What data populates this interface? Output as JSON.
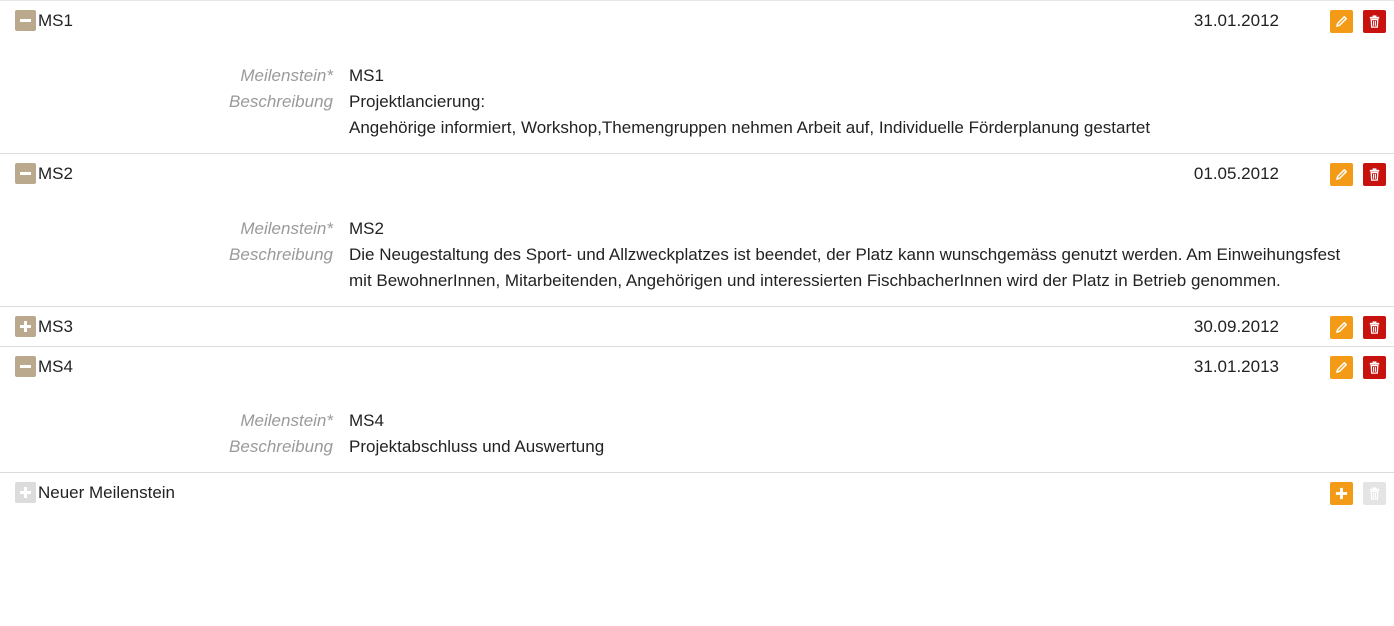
{
  "milestones": [
    {
      "name": "MS1",
      "date": "31.01.2012",
      "expanded": true,
      "fields": {
        "milestone_label": "Meilenstein*",
        "milestone_value": "MS1",
        "description_label": "Beschreibung",
        "description_value": "Projektlancierung:\nAngehörige informiert, Workshop,Themengruppen nehmen Arbeit auf, Individuelle Förderplanung gestartet"
      }
    },
    {
      "name": "MS2",
      "date": "01.05.2012",
      "expanded": true,
      "fields": {
        "milestone_label": "Meilenstein*",
        "milestone_value": "MS2",
        "description_label": "Beschreibung",
        "description_value": "Die Neugestaltung des Sport- und Allzweckplatzes ist beendet, der Platz kann wunschgemäss genutzt werden. Am Einweihungsfest mit BewohnerInnen, Mitarbeitenden, Angehörigen und interessierten FischbacherInnen wird der Platz in Betrieb genommen."
      }
    },
    {
      "name": "MS3",
      "date": "30.09.2012",
      "expanded": false
    },
    {
      "name": "MS4",
      "date": "31.01.2013",
      "expanded": true,
      "fields": {
        "milestone_label": "Meilenstein*",
        "milestone_value": "MS4",
        "description_label": "Beschreibung",
        "description_value": "Projektabschluss und Auswertung"
      }
    }
  ],
  "new_milestone": {
    "label": "Neuer Meilenstein"
  },
  "icons": {
    "collapse": "minus-icon",
    "expand": "plus-icon",
    "edit": "pencil-icon",
    "delete": "trash-icon",
    "add": "plus-icon"
  },
  "colors": {
    "toggle": "#bba98e",
    "edit": "#f39a16",
    "delete": "#c8120e",
    "disabled": "#dcdcdc"
  }
}
